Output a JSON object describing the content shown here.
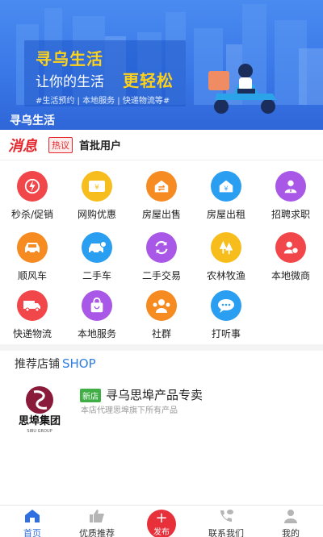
{
  "banner": {
    "headline": "寻乌生活",
    "subline": "让你的生活",
    "highlight": "更轻松",
    "tags": "#生活预约 | 本地服务 | 快递物流等#",
    "app_title": "寻乌生活"
  },
  "ticker": {
    "logo": "消息",
    "badge": "热议",
    "text": "首批用户"
  },
  "services": [
    {
      "label": "秒杀/促销",
      "icon": "flash-icon",
      "color": "#f2474a"
    },
    {
      "label": "网购优惠",
      "icon": "coupon-icon",
      "color": "#f7bd1c"
    },
    {
      "label": "房屋出售",
      "icon": "house-swap-icon",
      "color": "#f58b21"
    },
    {
      "label": "房屋出租",
      "icon": "house-yen-icon",
      "color": "#2a9ef0"
    },
    {
      "label": "招聘求职",
      "icon": "job-person-icon",
      "color": "#a957e6"
    },
    {
      "label": "顺风车",
      "icon": "car-icon",
      "color": "#f58b21"
    },
    {
      "label": "二手车",
      "icon": "used-car-icon",
      "color": "#2a9ef0"
    },
    {
      "label": "二手交易",
      "icon": "recycle-icon",
      "color": "#a957e6"
    },
    {
      "label": "农林牧渔",
      "icon": "trees-icon",
      "color": "#f7bd1c"
    },
    {
      "label": "本地微商",
      "icon": "merchant-icon",
      "color": "#f2474a"
    },
    {
      "label": "快递物流",
      "icon": "truck-icon",
      "color": "#f2474a"
    },
    {
      "label": "本地服务",
      "icon": "shopping-bag-icon",
      "color": "#a957e6"
    },
    {
      "label": "社群",
      "icon": "community-icon",
      "color": "#f58b21"
    },
    {
      "label": "打听事",
      "icon": "chat-icon",
      "color": "#2a9ef0"
    }
  ],
  "recommend": {
    "title": "推荐店铺",
    "title_en": "SHOP"
  },
  "shop": {
    "badge": "新店",
    "name": "寻乌思埠产品专卖",
    "desc": "本店代理思埠旗下所有产品",
    "logo_text": "思埠集团",
    "logo_sub": "SIBU GROUP"
  },
  "nav": {
    "home": "首页",
    "featured": "优质推荐",
    "publish": "发布",
    "contact": "联系我们",
    "mine": "我的"
  },
  "colors": {
    "accent": "#2f6fe0",
    "red": "#e8303a",
    "banner": "#3a78e8"
  }
}
